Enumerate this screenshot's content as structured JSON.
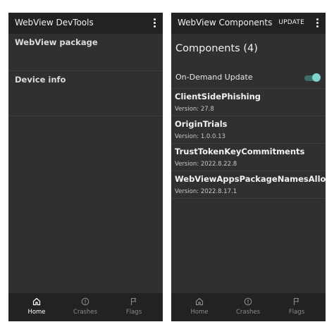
{
  "left_screen": {
    "title": "WebView DevTools",
    "menu_icon": "more-vert-icon",
    "sections": [
      {
        "label": "WebView package"
      },
      {
        "label": "Device info"
      }
    ],
    "bottom_nav": [
      {
        "label": "Home",
        "icon": "home-icon",
        "selected": true
      },
      {
        "label": "Crashes",
        "icon": "alert-circle-icon",
        "selected": false
      },
      {
        "label": "Flags",
        "icon": "flag-icon",
        "selected": false
      }
    ]
  },
  "right_screen": {
    "title": "WebView Components",
    "update_label": "UPDATE",
    "menu_icon": "more-vert-icon",
    "heading": "Components (4)",
    "on_demand": {
      "label": "On-Demand Update",
      "enabled": true
    },
    "components": [
      {
        "name": "ClientSidePhishing",
        "version": "Version: 27.8"
      },
      {
        "name": "OriginTrials",
        "version": "Version: 1.0.0.13"
      },
      {
        "name": "TrustTokenKeyCommitments",
        "version": "Version: 2022.8.22.8"
      },
      {
        "name": "WebViewAppsPackageNamesAllowlist",
        "version": "Version: 2022.8.17.1"
      }
    ],
    "bottom_nav": [
      {
        "label": "Home",
        "icon": "home-icon",
        "selected": false
      },
      {
        "label": "Crashes",
        "icon": "alert-circle-icon",
        "selected": false
      },
      {
        "label": "Flags",
        "icon": "flag-icon",
        "selected": false
      }
    ]
  },
  "colors": {
    "background": "#303030",
    "app_bar": "#222222",
    "nav_selected": "#ffffff",
    "nav_unselected": "#8a8a8a",
    "toggle_thumb": "#7fd3cc",
    "toggle_track": "#3f6c6a"
  }
}
